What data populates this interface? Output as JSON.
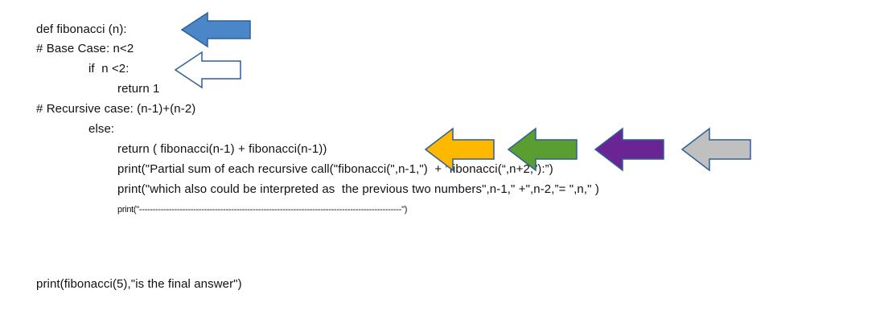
{
  "code": {
    "line1": "def fibonacci (n):",
    "line2": "# Base Case: n<2",
    "line3": "if  n <2:",
    "line4": "return 1",
    "line5": "# Recursive case: (n-1)+(n-2)",
    "line6": "else:",
    "line7": "return ( fibonacci(n-1) + fibonacci(n-1))",
    "line8": "print(\"Partial sum of each recursive call(\"fibonacci(\",n-1,\")  + ”fibonacci(“,n+2,”):”)",
    "line9": "print(\"which also could be interpreted as  the previous two numbers\",n-1,\" +\",n-2,”= \",n,\" )",
    "line10": "print(\"-------------------------------------------------------------------------------------------------\")",
    "line11": "print(fibonacci(5),\"is the final answer\")"
  },
  "arrows": {
    "def_arrow": {
      "icon": "left-arrow-icon",
      "fill": "#4a86c8",
      "stroke": "#2f5f96"
    },
    "base_case_arrow": {
      "icon": "left-arrow-icon",
      "fill": "#ffffff",
      "stroke": "#2f5f96"
    },
    "recursive_arrows": [
      {
        "icon": "left-arrow-icon",
        "fill": "#ffb800",
        "stroke": "#2f5f96"
      },
      {
        "icon": "left-arrow-icon",
        "fill": "#5a9e32",
        "stroke": "#2f5f96"
      },
      {
        "icon": "left-arrow-icon",
        "fill": "#6a2494",
        "stroke": "#2f5f96"
      },
      {
        "icon": "left-arrow-icon",
        "fill": "#c0c0c0",
        "stroke": "#2f5f96"
      }
    ]
  }
}
